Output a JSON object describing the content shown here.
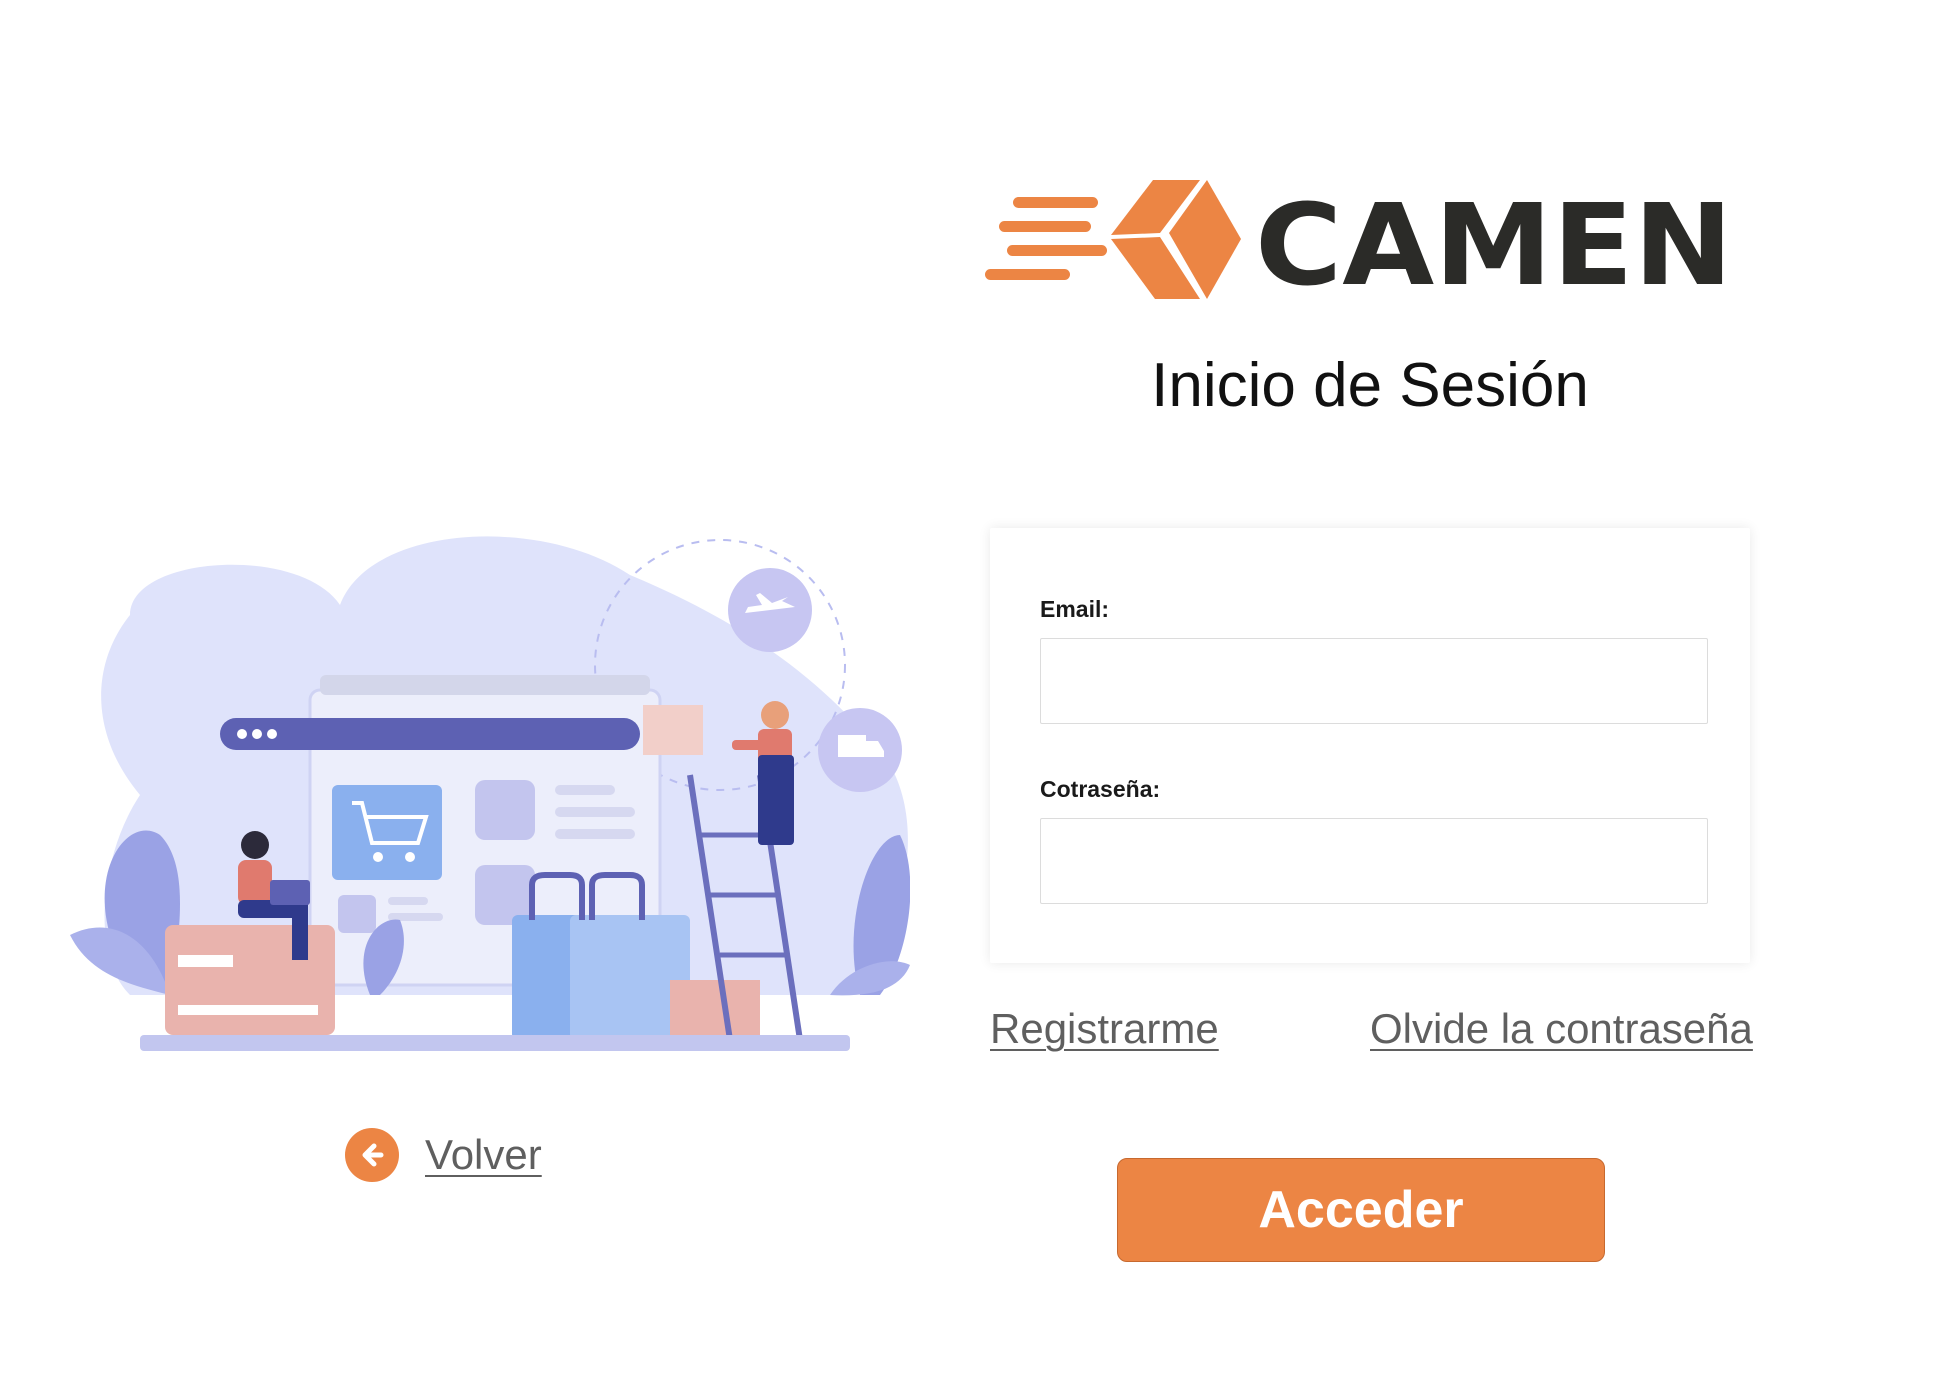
{
  "brand": {
    "name": "CAMEN",
    "accent_color": "#ec8544",
    "text_color": "#2b2b28"
  },
  "page": {
    "title": "Inicio de Sesión"
  },
  "form": {
    "email_label": "Email:",
    "email_value": "",
    "password_label": "Cotraseña:",
    "password_value": ""
  },
  "links": {
    "register": "Registrarme",
    "forgot_password": "Olvide la contraseña",
    "back": "Volver"
  },
  "actions": {
    "submit_label": "Acceder",
    "submit_color": "#ec8544"
  },
  "icons": {
    "back": "arrow-left-circle-icon",
    "logo": "delivery-box-logo-icon"
  }
}
